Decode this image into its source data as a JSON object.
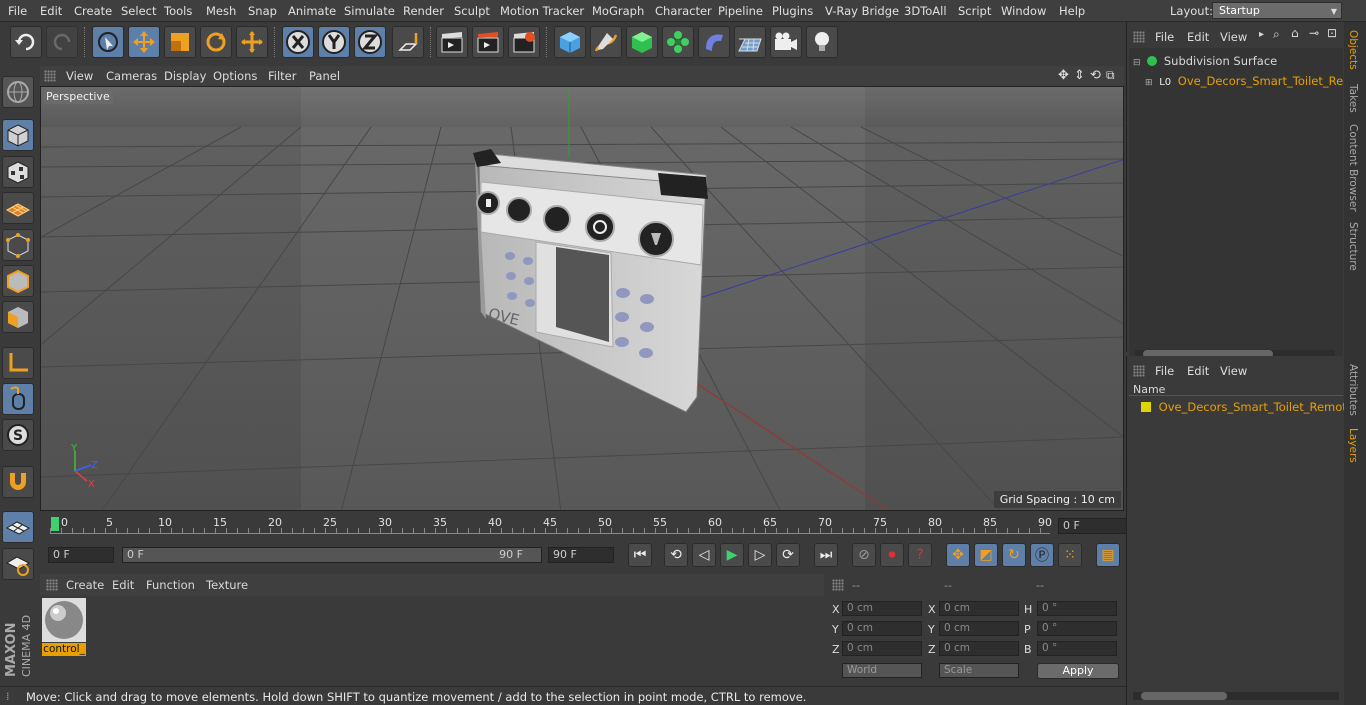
{
  "menubar": {
    "items": [
      "File",
      "Edit",
      "Create",
      "Select",
      "Tools",
      "Mesh",
      "Snap",
      "Animate",
      "Simulate",
      "Render",
      "Sculpt",
      "Motion Tracker",
      "MoGraph",
      "Character",
      "Pipeline",
      "Plugins",
      "V-Ray Bridge",
      "3DToAll",
      "Script",
      "Window",
      "Help"
    ],
    "layout_label": "Layout:",
    "layout_value": "Startup"
  },
  "viewport": {
    "menu": [
      "View",
      "Cameras",
      "Display",
      "Options",
      "Filter",
      "Panel"
    ],
    "camera_label": "Perspective",
    "grid_spacing": "Grid Spacing : 10 cm",
    "model_brand": "OVE"
  },
  "timeline": {
    "ticks": [
      "0",
      "5",
      "10",
      "15",
      "20",
      "25",
      "30",
      "35",
      "40",
      "45",
      "50",
      "55",
      "60",
      "65",
      "70",
      "75",
      "80",
      "85",
      "90"
    ],
    "current_frame": "0 F"
  },
  "transport": {
    "start_field": "0 F",
    "range_start": "0 F",
    "range_end": "90 F",
    "end_field": "90 F"
  },
  "material": {
    "menu": [
      "Create",
      "Edit",
      "Function",
      "Texture"
    ],
    "item_name": "control_"
  },
  "coordinates": {
    "headers": [
      "--",
      "--",
      "--"
    ],
    "rows": [
      {
        "a": "X",
        "av": "0 cm",
        "b": "X",
        "bv": "0 cm",
        "c": "H",
        "cv": "0 °"
      },
      {
        "a": "Y",
        "av": "0 cm",
        "b": "Y",
        "bv": "0 cm",
        "c": "P",
        "cv": "0 °"
      },
      {
        "a": "Z",
        "av": "0 cm",
        "b": "Z",
        "bv": "0 cm",
        "c": "B",
        "cv": "0 °"
      }
    ],
    "world": "World",
    "scale": "Scale",
    "apply": "Apply"
  },
  "objects_panel": {
    "menu": [
      "File",
      "Edit",
      "View"
    ],
    "items": [
      "Subdivision Surface",
      "Ove_Decors_Smart_Toilet_Remot"
    ]
  },
  "layers_panel": {
    "menu": [
      "File",
      "Edit",
      "View"
    ],
    "column": "Name",
    "items": [
      "Ove_Decors_Smart_Toilet_Remote"
    ]
  },
  "side_tabs": [
    "Objects",
    "Takes",
    "Content Browser",
    "Structure",
    "Attributes",
    "Layers"
  ],
  "status": "Move: Click and drag to move elements. Hold down SHIFT to quantize movement / add to the selection in point mode, CTRL to remove.",
  "brand": {
    "maxon": "MAXON",
    "cinema": "CINEMA 4D"
  },
  "colors": {
    "accent": "#5d7fa8",
    "highlight": "#e8a000",
    "layer_color": "#e0d400"
  }
}
